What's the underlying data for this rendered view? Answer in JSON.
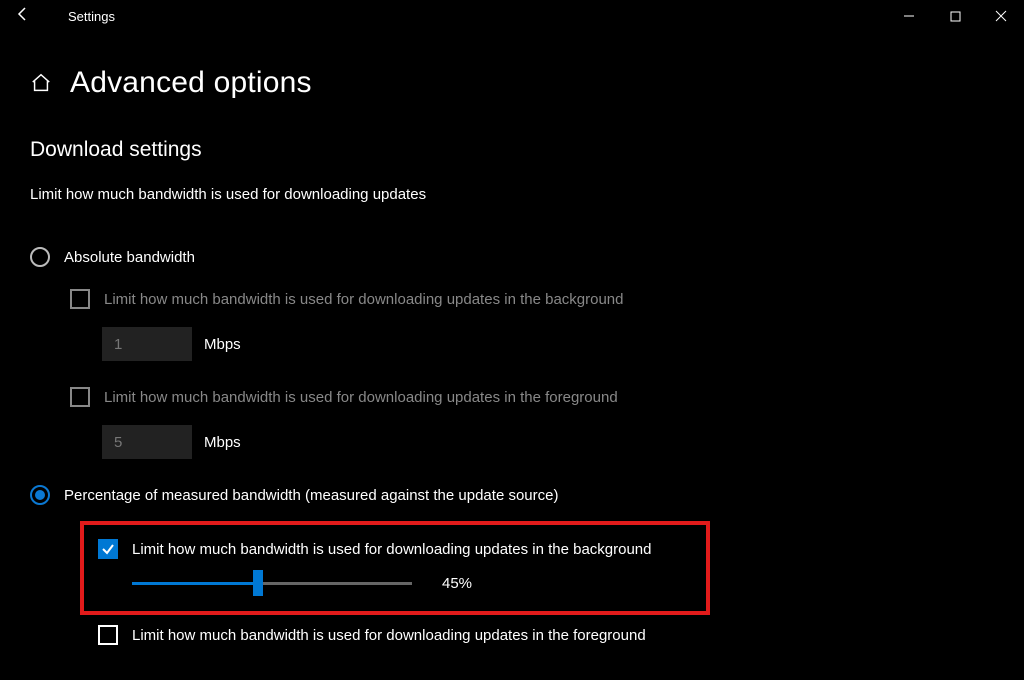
{
  "titlebar": {
    "back_icon": "back",
    "title": "Settings"
  },
  "header": {
    "home_icon": "home",
    "title": "Advanced options"
  },
  "section": {
    "title": "Download settings",
    "desc": "Limit how much bandwidth is used for downloading updates"
  },
  "absolute": {
    "radio_label": "Absolute bandwidth",
    "bg_label": "Limit how much bandwidth is used for downloading updates in the background",
    "bg_value": "1",
    "bg_unit": "Mbps",
    "fg_label": "Limit how much bandwidth is used for downloading updates in the foreground",
    "fg_value": "5",
    "fg_unit": "Mbps"
  },
  "percentage": {
    "radio_label": "Percentage of measured bandwidth (measured against the update source)",
    "bg_label": "Limit how much bandwidth is used for downloading updates in the background",
    "slider_value": 45,
    "slider_label": "45%",
    "fg_label": "Limit how much bandwidth is used for downloading updates in the foreground"
  },
  "colors": {
    "accent": "#0078d4",
    "highlight": "#e21b1b"
  }
}
